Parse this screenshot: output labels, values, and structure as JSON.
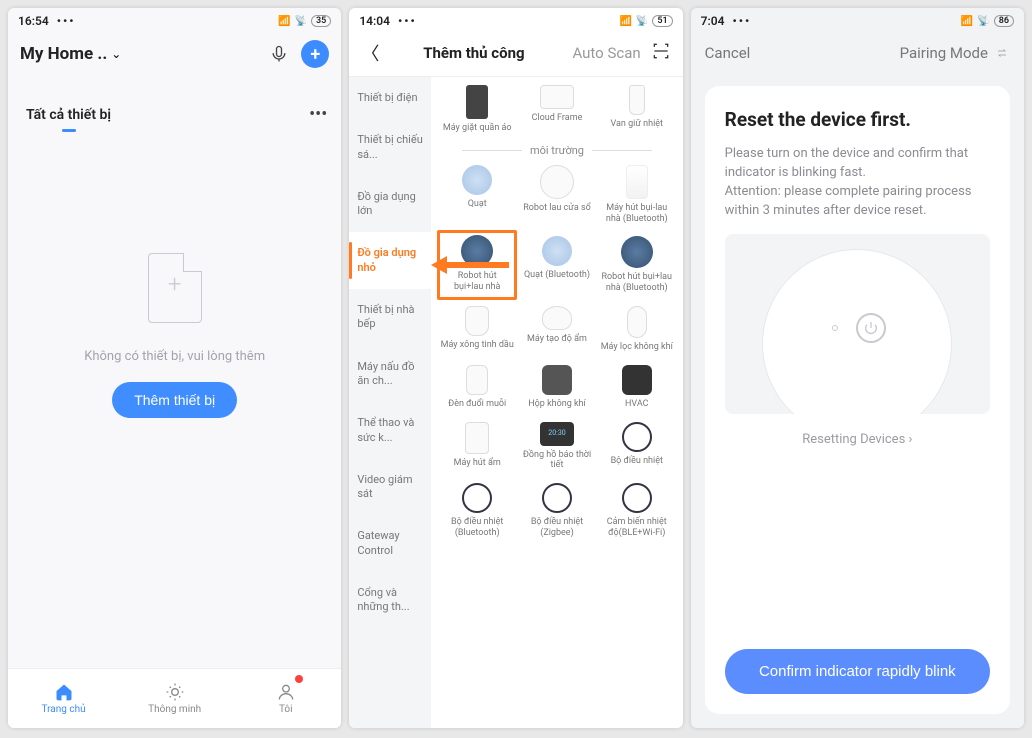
{
  "screen1": {
    "status": {
      "time": "16:54",
      "battery": "35"
    },
    "home_label": "My Home ..",
    "tab_all": "Tất cả thiết bị",
    "empty_text": "Không có thiết bị, vui lòng thêm",
    "add_btn": "Thêm thiết bị",
    "nav": {
      "home": "Trang chủ",
      "smart": "Thông minh",
      "me": "Tôi"
    }
  },
  "screen2": {
    "status": {
      "time": "14:04",
      "battery": "51"
    },
    "title_active": "Thêm thủ công",
    "title_alt": "Auto Scan",
    "categories": [
      "Thiết bị điện",
      "Thiết bị chiếu sá...",
      "Đồ gia dụng lớn",
      "Đồ gia dụng nhỏ",
      "Thiết bị nhà bếp",
      "Máy nấu đồ ăn ch...",
      "Thể thao và sức k...",
      "Video giám sát",
      "Gateway Control",
      "Cổng và những th..."
    ],
    "active_category_index": 3,
    "section_env": "môi trường",
    "items_top": [
      {
        "label": "Máy giặt quần áo"
      },
      {
        "label": "Cloud Frame"
      },
      {
        "label": "Van giữ nhiệt"
      }
    ],
    "items_env1": [
      {
        "label": "Quạt"
      },
      {
        "label": "Robot lau cửa sổ"
      },
      {
        "label": "Máy hút bụi-lau nhà (Bluetooth)"
      }
    ],
    "items_env2": [
      {
        "label": "Robot hút bụi+lau nhà",
        "highlight": true
      },
      {
        "label": "Quạt (Bluetooth)"
      },
      {
        "label": "Robot hút bụi+lau nhà (Bluetooth)"
      }
    ],
    "items_env3": [
      {
        "label": "Máy xông tinh dầu"
      },
      {
        "label": "Máy tạo độ ẩm"
      },
      {
        "label": "Máy lọc không khí"
      }
    ],
    "items_env4": [
      {
        "label": "Đèn đuổi muỗi"
      },
      {
        "label": "Hộp không khí"
      },
      {
        "label": "HVAC"
      }
    ],
    "items_env5": [
      {
        "label": "Máy hút ẩm"
      },
      {
        "label": "Đồng hồ báo thời tiết"
      },
      {
        "label": "Bộ điều nhiệt"
      }
    ],
    "items_env6": [
      {
        "label": "Bộ điều nhiệt (Bluetooth)"
      },
      {
        "label": "Bộ điều nhiệt (Zigbee)"
      },
      {
        "label": "Cảm biến nhiệt độ(BLE+Wi-Fi)"
      }
    ]
  },
  "screen3": {
    "status": {
      "time": "7:04",
      "battery": "86"
    },
    "cancel": "Cancel",
    "pairing_mode": "Pairing Mode",
    "heading": "Reset the device first.",
    "para1": "Please turn on the device and confirm that indicator is blinking fast.",
    "para2": "Attention: please complete pairing process within 3 minutes after device reset.",
    "resetting": "Resetting Devices",
    "confirm": "Confirm indicator rapidly blink"
  }
}
